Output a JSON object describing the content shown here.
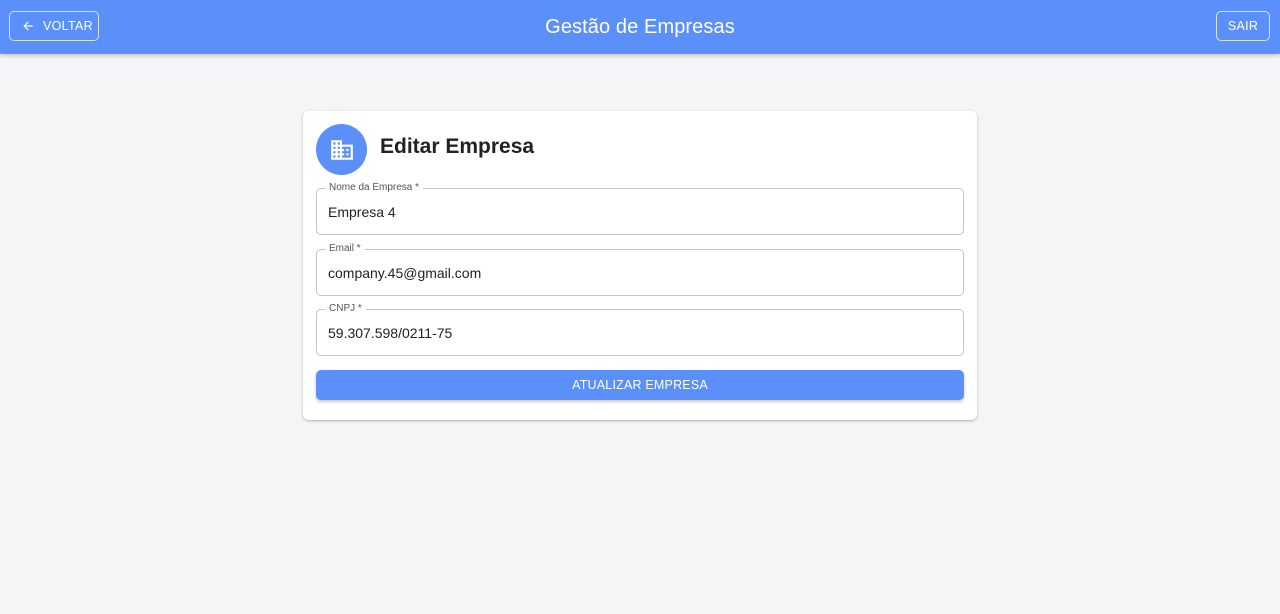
{
  "header": {
    "title": "Gestão de Empresas",
    "back_label": "VOLTAR",
    "logout_label": "SAIR",
    "back_icon": "arrow-left-icon"
  },
  "form": {
    "title": "Editar Empresa",
    "icon": "building-icon",
    "fields": [
      {
        "label": "Nome da Empresa *",
        "value": "Empresa 4"
      },
      {
        "label": "Email *",
        "value": "company.45@gmail.com"
      },
      {
        "label": "CNPJ *",
        "value": "59.307.598/0211-75"
      }
    ],
    "submit_label": "ATUALIZAR EMPRESA"
  },
  "colors": {
    "primary": "#5b8ff9",
    "background": "#f4f5f7"
  }
}
